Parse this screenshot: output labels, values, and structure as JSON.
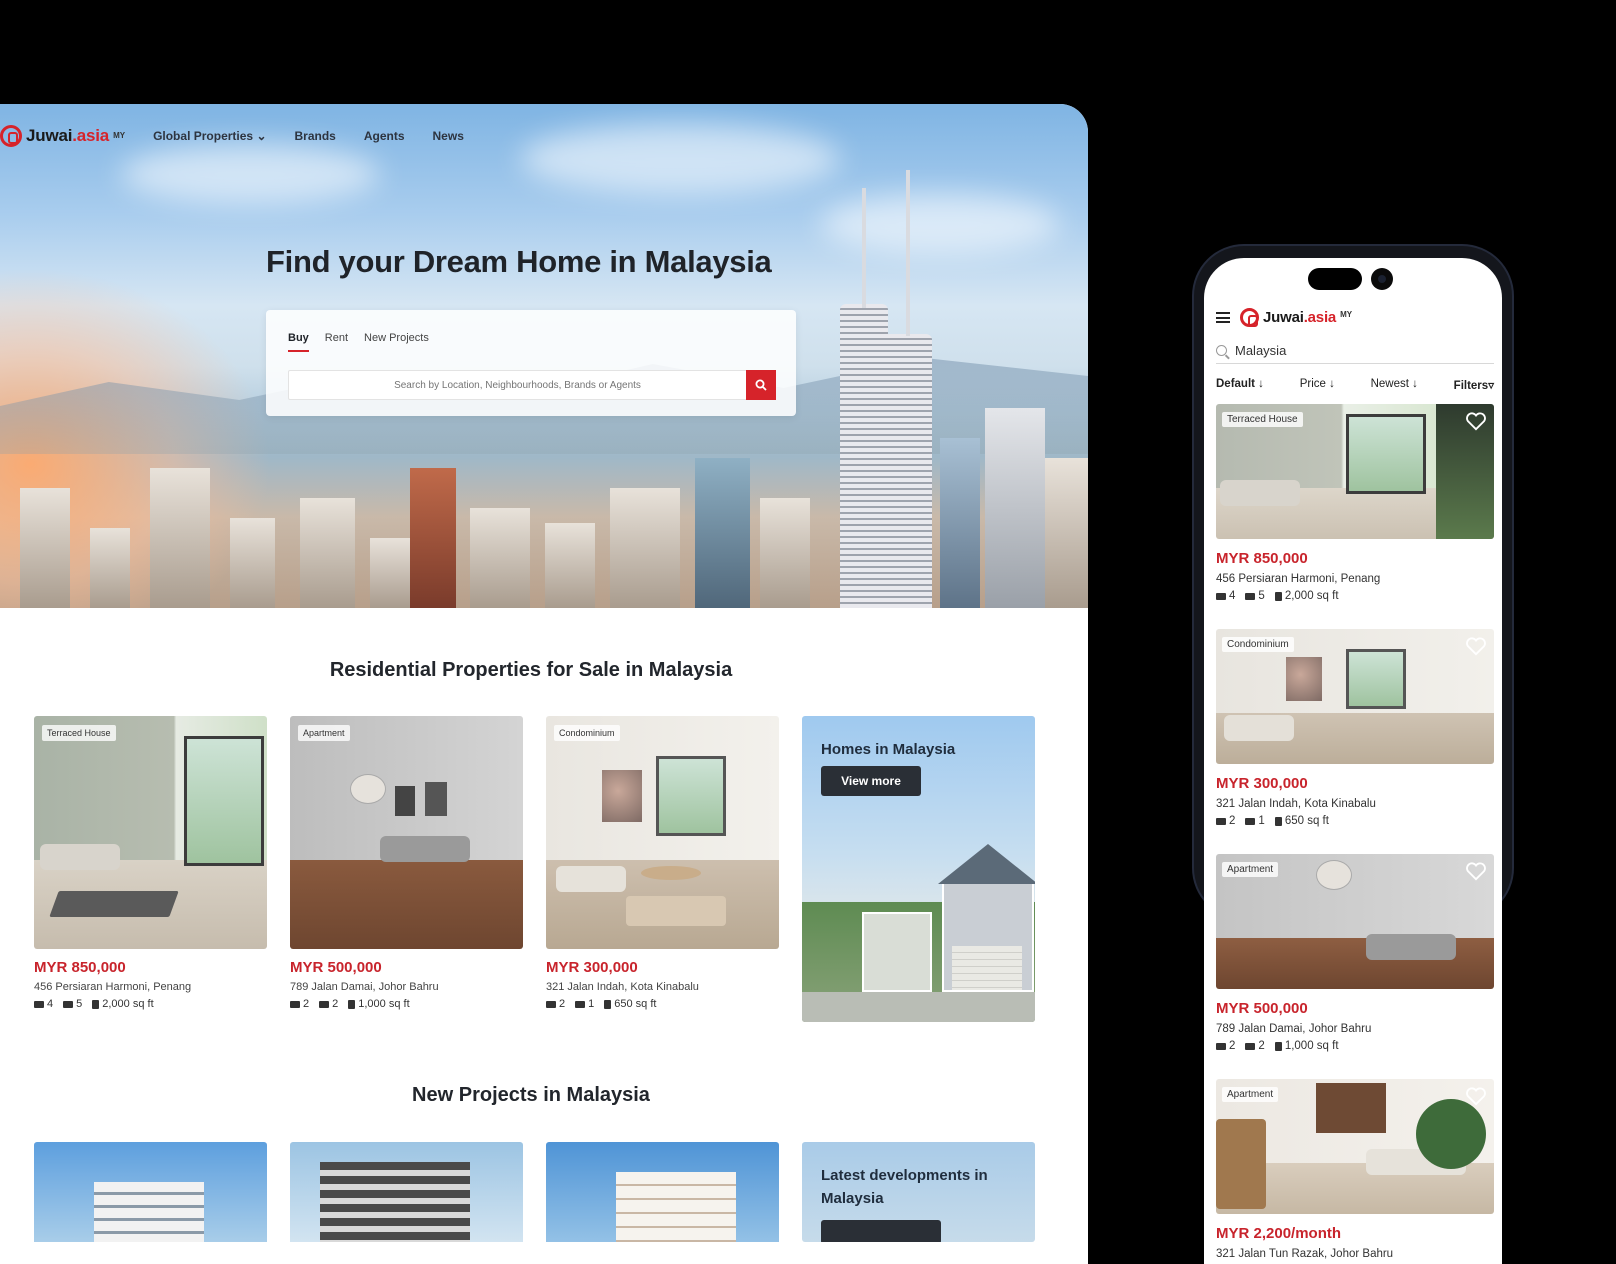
{
  "desktop": {
    "brand": {
      "name": "Juwai",
      "suffix": ".asia",
      "region": "MY"
    },
    "nav": [
      "Global Properties",
      "Brands",
      "Agents",
      "News"
    ],
    "hero_title": "Find your Dream Home in Malaysia",
    "search": {
      "tabs": [
        "Buy",
        "Rent",
        "New Projects"
      ],
      "active_tab": "Buy",
      "placeholder": "Search by Location, Neighbourhoods, Brands or Agents"
    },
    "residential": {
      "title": "Residential Properties for Sale in Malaysia",
      "listings": [
        {
          "type": "Terraced House",
          "price": "MYR 850,000",
          "address": "456 Persiaran Harmoni, Penang",
          "beds": "4",
          "baths": "5",
          "area": "2,000 sq ft"
        },
        {
          "type": "Apartment",
          "price": "MYR 500,000",
          "address": "789 Jalan Damai, Johor Bahru",
          "beds": "2",
          "baths": "2",
          "area": "1,000 sq ft"
        },
        {
          "type": "Condominium",
          "price": "MYR 300,000",
          "address": "321 Jalan Indah, Kota Kinabalu",
          "beds": "2",
          "baths": "1",
          "area": "650 sq ft"
        }
      ],
      "promo": {
        "title": "Homes in Malaysia",
        "button": "View more"
      }
    },
    "projects": {
      "title": "New Projects in Malaysia",
      "promo": {
        "title": "Latest developments in Malaysia"
      }
    }
  },
  "mobile": {
    "brand": {
      "name": "Juwai",
      "suffix": ".asia",
      "region": "MY"
    },
    "search_value": "Malaysia",
    "sort": [
      "Default ↓",
      "Price ↓",
      "Newest ↓",
      "Filters"
    ],
    "listings": [
      {
        "type": "Terraced House",
        "price": "MYR 850,000",
        "address": "456 Persiaran Harmoni, Penang",
        "beds": "4",
        "baths": "5",
        "area": "2,000 sq ft"
      },
      {
        "type": "Condominium",
        "price": "MYR 300,000",
        "address": "321 Jalan Indah, Kota Kinabalu",
        "beds": "2",
        "baths": "1",
        "area": "650 sq ft"
      },
      {
        "type": "Apartment",
        "price": "MYR 500,000",
        "address": "789 Jalan Damai, Johor Bahru",
        "beds": "2",
        "baths": "2",
        "area": "1,000 sq ft"
      },
      {
        "type": "Apartment",
        "price": "MYR 2,200/month",
        "address": "321 Jalan Tun Razak, Johor Bahru",
        "beds": "",
        "baths": "",
        "area": ""
      }
    ]
  },
  "colors": {
    "brand_red": "#d6232a",
    "price_red": "#c8242c",
    "dark_button": "#2a2f36"
  }
}
